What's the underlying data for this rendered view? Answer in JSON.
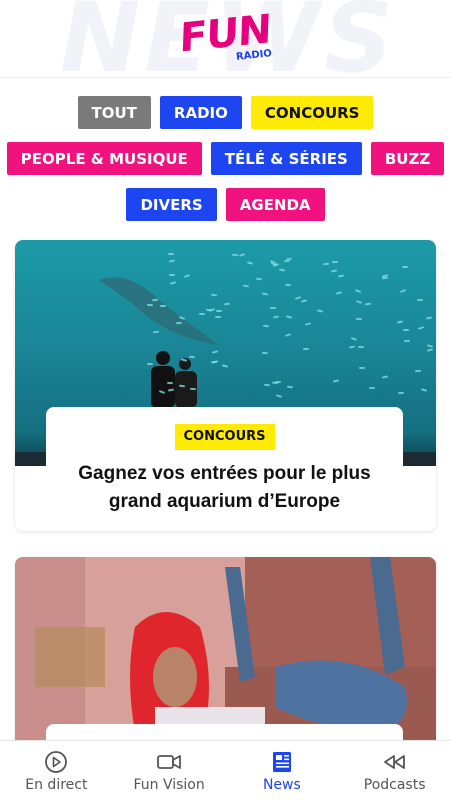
{
  "header": {
    "background_word": "NEWS",
    "logo_main": "FUN",
    "logo_sub": "RADIO"
  },
  "filters": {
    "row1": [
      {
        "label": "TOUT",
        "color": "#7a7a7a"
      },
      {
        "label": "RADIO",
        "color": "#1e46f0"
      },
      {
        "label": "CONCOURS",
        "color": "#ffeb00"
      }
    ],
    "row2": [
      {
        "label": "PEOPLE & MUSIQUE",
        "color": "#f0137f"
      },
      {
        "label": "TÉLÉ & SÉRIES",
        "color": "#1e46f0"
      },
      {
        "label": "BUZZ",
        "color": "#f0137f"
      }
    ],
    "row3": [
      {
        "label": "DIVERS",
        "color": "#1e46f0"
      },
      {
        "label": "AGENDA",
        "color": "#f0137f"
      }
    ]
  },
  "articles": [
    {
      "tag": "CONCOURS",
      "title": "Gagnez vos entrées pour le plus grand aquarium d’Europe",
      "image_icon": "aquarium-photo"
    },
    {
      "tag": "",
      "title": "",
      "image_icon": "singer-photo"
    }
  ],
  "bottom_nav": [
    {
      "label": "En direct",
      "icon": "play-circle-icon",
      "active": false
    },
    {
      "label": "Fun Vision",
      "icon": "video-camera-icon",
      "active": false
    },
    {
      "label": "News",
      "icon": "newspaper-icon",
      "active": true
    },
    {
      "label": "Podcasts",
      "icon": "rewind-icon",
      "active": false
    }
  ],
  "colors": {
    "accent_blue": "#1e46f0",
    "accent_pink": "#f0137f",
    "accent_yellow": "#ffeb00",
    "gray": "#7a7a7a"
  }
}
